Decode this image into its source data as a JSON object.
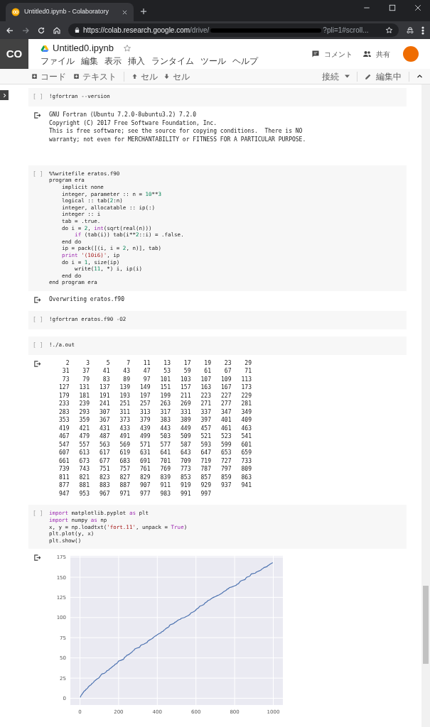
{
  "browser": {
    "tab_title": "Untitled0.ipynb - Colaboratory",
    "url_host": "https://colab.research.google.com",
    "url_path": "/drive/",
    "url_tail": "?pli=1#scroll..."
  },
  "header": {
    "logo": "CO",
    "notebook_title": "Untitled0.ipynb",
    "starred": false,
    "menu": [
      "ファイル",
      "編集",
      "表示",
      "挿入",
      "ランタイム",
      "ツール",
      "ヘルプ"
    ],
    "comment_label": "コメント",
    "share_label": "共有"
  },
  "toolbar": {
    "add_code": "コード",
    "add_text": "テキスト",
    "cell_up": "セル",
    "cell_down": "セル",
    "connect": "接続",
    "edit_mode": "編集中"
  },
  "cells": [
    {
      "run_label": "[ ]",
      "lines": [
        "!gfortran --version"
      ],
      "output": {
        "kind": "text",
        "lines": [
          "GNU Fortran (Ubuntu 7.2.0-8ubuntu3.2) 7.2.0",
          "Copyright (C) 2017 Free Software Foundation, Inc.",
          "This is free software; see the source for copying conditions.  There is NO",
          "warranty; not even for MERCHANTABILITY or FITNESS FOR A PARTICULAR PURPOSE."
        ]
      }
    },
    {
      "run_label": "[ ]",
      "lines": [
        "%%writefile eratos.f90",
        "program era",
        "    implicit none",
        [
          "    integer, parameter :: n = ",
          {
            "text": "10",
            "kind": "number"
          },
          "**",
          {
            "text": "3",
            "kind": "number"
          }
        ],
        [
          "    logical :: tab(",
          {
            "text": "2",
            "kind": "number"
          },
          ":n)"
        ],
        "    integer, allocatable :: ip(:)",
        "    integer :: i",
        "    tab = .true.",
        [
          "    do i = ",
          {
            "text": "2",
            "kind": "number"
          },
          ", ",
          {
            "text": "int",
            "kind": "keyword"
          },
          "(sqrt(real(n)))"
        ],
        [
          {
            "text": "        if",
            "kind": "keyword"
          },
          " (tab(i)) tab(i**",
          {
            "text": "2",
            "kind": "number"
          },
          "::i) = .false."
        ],
        "    end do",
        [
          "    ip = pack([(i, i = ",
          {
            "text": "2",
            "kind": "number"
          },
          ", n)], tab)"
        ],
        [
          {
            "text": "    print",
            "kind": "keyword"
          },
          {
            "text": " '(10i6)'",
            "kind": "string"
          },
          ", ip"
        ],
        [
          "    do i = ",
          {
            "text": "1",
            "kind": "number"
          },
          ", size(ip)"
        ],
        [
          "        write(",
          {
            "text": "11",
            "kind": "number"
          },
          ", *) i, ip(i)"
        ],
        "    end do",
        "end program era"
      ],
      "output": {
        "kind": "text",
        "lines": [
          "Overwriting eratos.f90"
        ]
      }
    },
    {
      "run_label": "[ ]",
      "lines": [
        "!gfortran eratos.f90 -O2"
      ]
    },
    {
      "run_label": "[ ]",
      "lines": [
        "!./a.out"
      ],
      "output": {
        "kind": "table",
        "rows": [
          [
            "2",
            "3",
            "5",
            "7",
            "11",
            "13",
            "17",
            "19",
            "23",
            "29"
          ],
          [
            "31",
            "37",
            "41",
            "43",
            "47",
            "53",
            "59",
            "61",
            "67",
            "71"
          ],
          [
            "73",
            "79",
            "83",
            "89",
            "97",
            "101",
            "103",
            "107",
            "109",
            "113"
          ],
          [
            "127",
            "131",
            "137",
            "139",
            "149",
            "151",
            "157",
            "163",
            "167",
            "173"
          ],
          [
            "179",
            "181",
            "191",
            "193",
            "197",
            "199",
            "211",
            "223",
            "227",
            "229"
          ],
          [
            "233",
            "239",
            "241",
            "251",
            "257",
            "263",
            "269",
            "271",
            "277",
            "281"
          ],
          [
            "283",
            "293",
            "307",
            "311",
            "313",
            "317",
            "331",
            "337",
            "347",
            "349"
          ],
          [
            "353",
            "359",
            "367",
            "373",
            "379",
            "383",
            "389",
            "397",
            "401",
            "409"
          ],
          [
            "419",
            "421",
            "431",
            "433",
            "439",
            "443",
            "449",
            "457",
            "461",
            "463"
          ],
          [
            "467",
            "479",
            "487",
            "491",
            "499",
            "503",
            "509",
            "521",
            "523",
            "541"
          ],
          [
            "547",
            "557",
            "563",
            "569",
            "571",
            "577",
            "587",
            "593",
            "599",
            "601"
          ],
          [
            "607",
            "613",
            "617",
            "619",
            "631",
            "641",
            "643",
            "647",
            "653",
            "659"
          ],
          [
            "661",
            "673",
            "677",
            "683",
            "691",
            "701",
            "709",
            "719",
            "727",
            "733"
          ],
          [
            "739",
            "743",
            "751",
            "757",
            "761",
            "769",
            "773",
            "787",
            "797",
            "809"
          ],
          [
            "811",
            "821",
            "823",
            "827",
            "829",
            "839",
            "853",
            "857",
            "859",
            "863"
          ],
          [
            "877",
            "881",
            "883",
            "887",
            "907",
            "911",
            "919",
            "929",
            "937",
            "941"
          ],
          [
            "947",
            "953",
            "967",
            "971",
            "977",
            "983",
            "991",
            "997"
          ]
        ]
      }
    },
    {
      "run_label": "[ ]",
      "lines": [
        [
          {
            "text": "import",
            "kind": "keyword"
          },
          " matplotlib.pyplot ",
          {
            "text": "as",
            "kind": "keyword"
          },
          " plt"
        ],
        [
          {
            "text": "import",
            "kind": "keyword"
          },
          " numpy ",
          {
            "text": "as",
            "kind": "keyword"
          },
          " np"
        ],
        [
          "x, y = np.loadtxt(",
          {
            "text": "'fort.11'",
            "kind": "string"
          },
          ", unpack = ",
          {
            "text": "True",
            "kind": "keyword"
          },
          ")"
        ],
        "plt.plot(y, x)",
        "plt.show()"
      ],
      "output": {
        "kind": "chart",
        "chart_data": {
          "type": "line",
          "x": [
            2,
            3,
            5,
            7,
            11,
            13,
            17,
            19,
            23,
            29,
            31,
            37,
            41,
            43,
            47,
            53,
            59,
            61,
            67,
            71,
            73,
            79,
            83,
            89,
            97,
            101,
            103,
            107,
            109,
            113,
            127,
            131,
            137,
            139,
            149,
            151,
            157,
            163,
            167,
            173,
            179,
            181,
            191,
            193,
            197,
            199,
            211,
            223,
            227,
            229,
            233,
            239,
            241,
            251,
            257,
            263,
            269,
            271,
            277,
            281,
            283,
            293,
            307,
            311,
            313,
            317,
            331,
            337,
            347,
            349,
            353,
            359,
            367,
            373,
            379,
            383,
            389,
            397,
            401,
            409,
            419,
            421,
            431,
            433,
            439,
            443,
            449,
            457,
            461,
            463,
            467,
            479,
            487,
            491,
            499,
            503,
            509,
            521,
            523,
            541,
            547,
            557,
            563,
            569,
            571,
            577,
            587,
            593,
            599,
            601,
            607,
            613,
            617,
            619,
            631,
            641,
            643,
            647,
            653,
            659,
            661,
            673,
            677,
            683,
            691,
            701,
            709,
            719,
            727,
            733,
            739,
            743,
            751,
            757,
            761,
            769,
            773,
            787,
            797,
            809,
            811,
            821,
            823,
            827,
            829,
            839,
            853,
            857,
            859,
            863,
            877,
            881,
            883,
            887,
            907,
            911,
            919,
            929,
            937,
            941,
            947,
            953,
            967,
            971,
            977,
            983,
            991,
            997
          ],
          "grid": true,
          "series": [
            {
              "color": "#4c72b0",
              "values": [
                1,
                2,
                3,
                4,
                5,
                6,
                7,
                8,
                9,
                10,
                11,
                12,
                13,
                14,
                15,
                16,
                17,
                18,
                19,
                20,
                21,
                22,
                23,
                24,
                25,
                26,
                27,
                28,
                29,
                30,
                31,
                32,
                33,
                34,
                35,
                36,
                37,
                38,
                39,
                40,
                41,
                42,
                43,
                44,
                45,
                46,
                47,
                48,
                49,
                50,
                51,
                52,
                53,
                54,
                55,
                56,
                57,
                58,
                59,
                60,
                61,
                62,
                63,
                64,
                65,
                66,
                67,
                68,
                69,
                70,
                71,
                72,
                73,
                74,
                75,
                76,
                77,
                78,
                79,
                80,
                81,
                82,
                83,
                84,
                85,
                86,
                87,
                88,
                89,
                90,
                91,
                92,
                93,
                94,
                95,
                96,
                97,
                98,
                99,
                100,
                101,
                102,
                103,
                104,
                105,
                106,
                107,
                108,
                109,
                110,
                111,
                112,
                113,
                114,
                115,
                116,
                117,
                118,
                119,
                120,
                121,
                122,
                123,
                124,
                125,
                126,
                127,
                128,
                129,
                130,
                131,
                132,
                133,
                134,
                135,
                136,
                137,
                138,
                139,
                140,
                141,
                142,
                143,
                144,
                145,
                146,
                147,
                148,
                149,
                150,
                151,
                152,
                153,
                154,
                155,
                156,
                157,
                158,
                159,
                160,
                161,
                162,
                163,
                164,
                165,
                166,
                167,
                168
              ]
            }
          ],
          "xlim": [
            -49.75,
            1049.75
          ],
          "ylim": [
            -8.35,
            176.35
          ],
          "xticks": [
            0,
            200,
            400,
            600,
            800,
            1000
          ],
          "yticks": [
            0,
            25,
            50,
            75,
            100,
            125,
            150,
            175
          ]
        }
      }
    }
  ]
}
